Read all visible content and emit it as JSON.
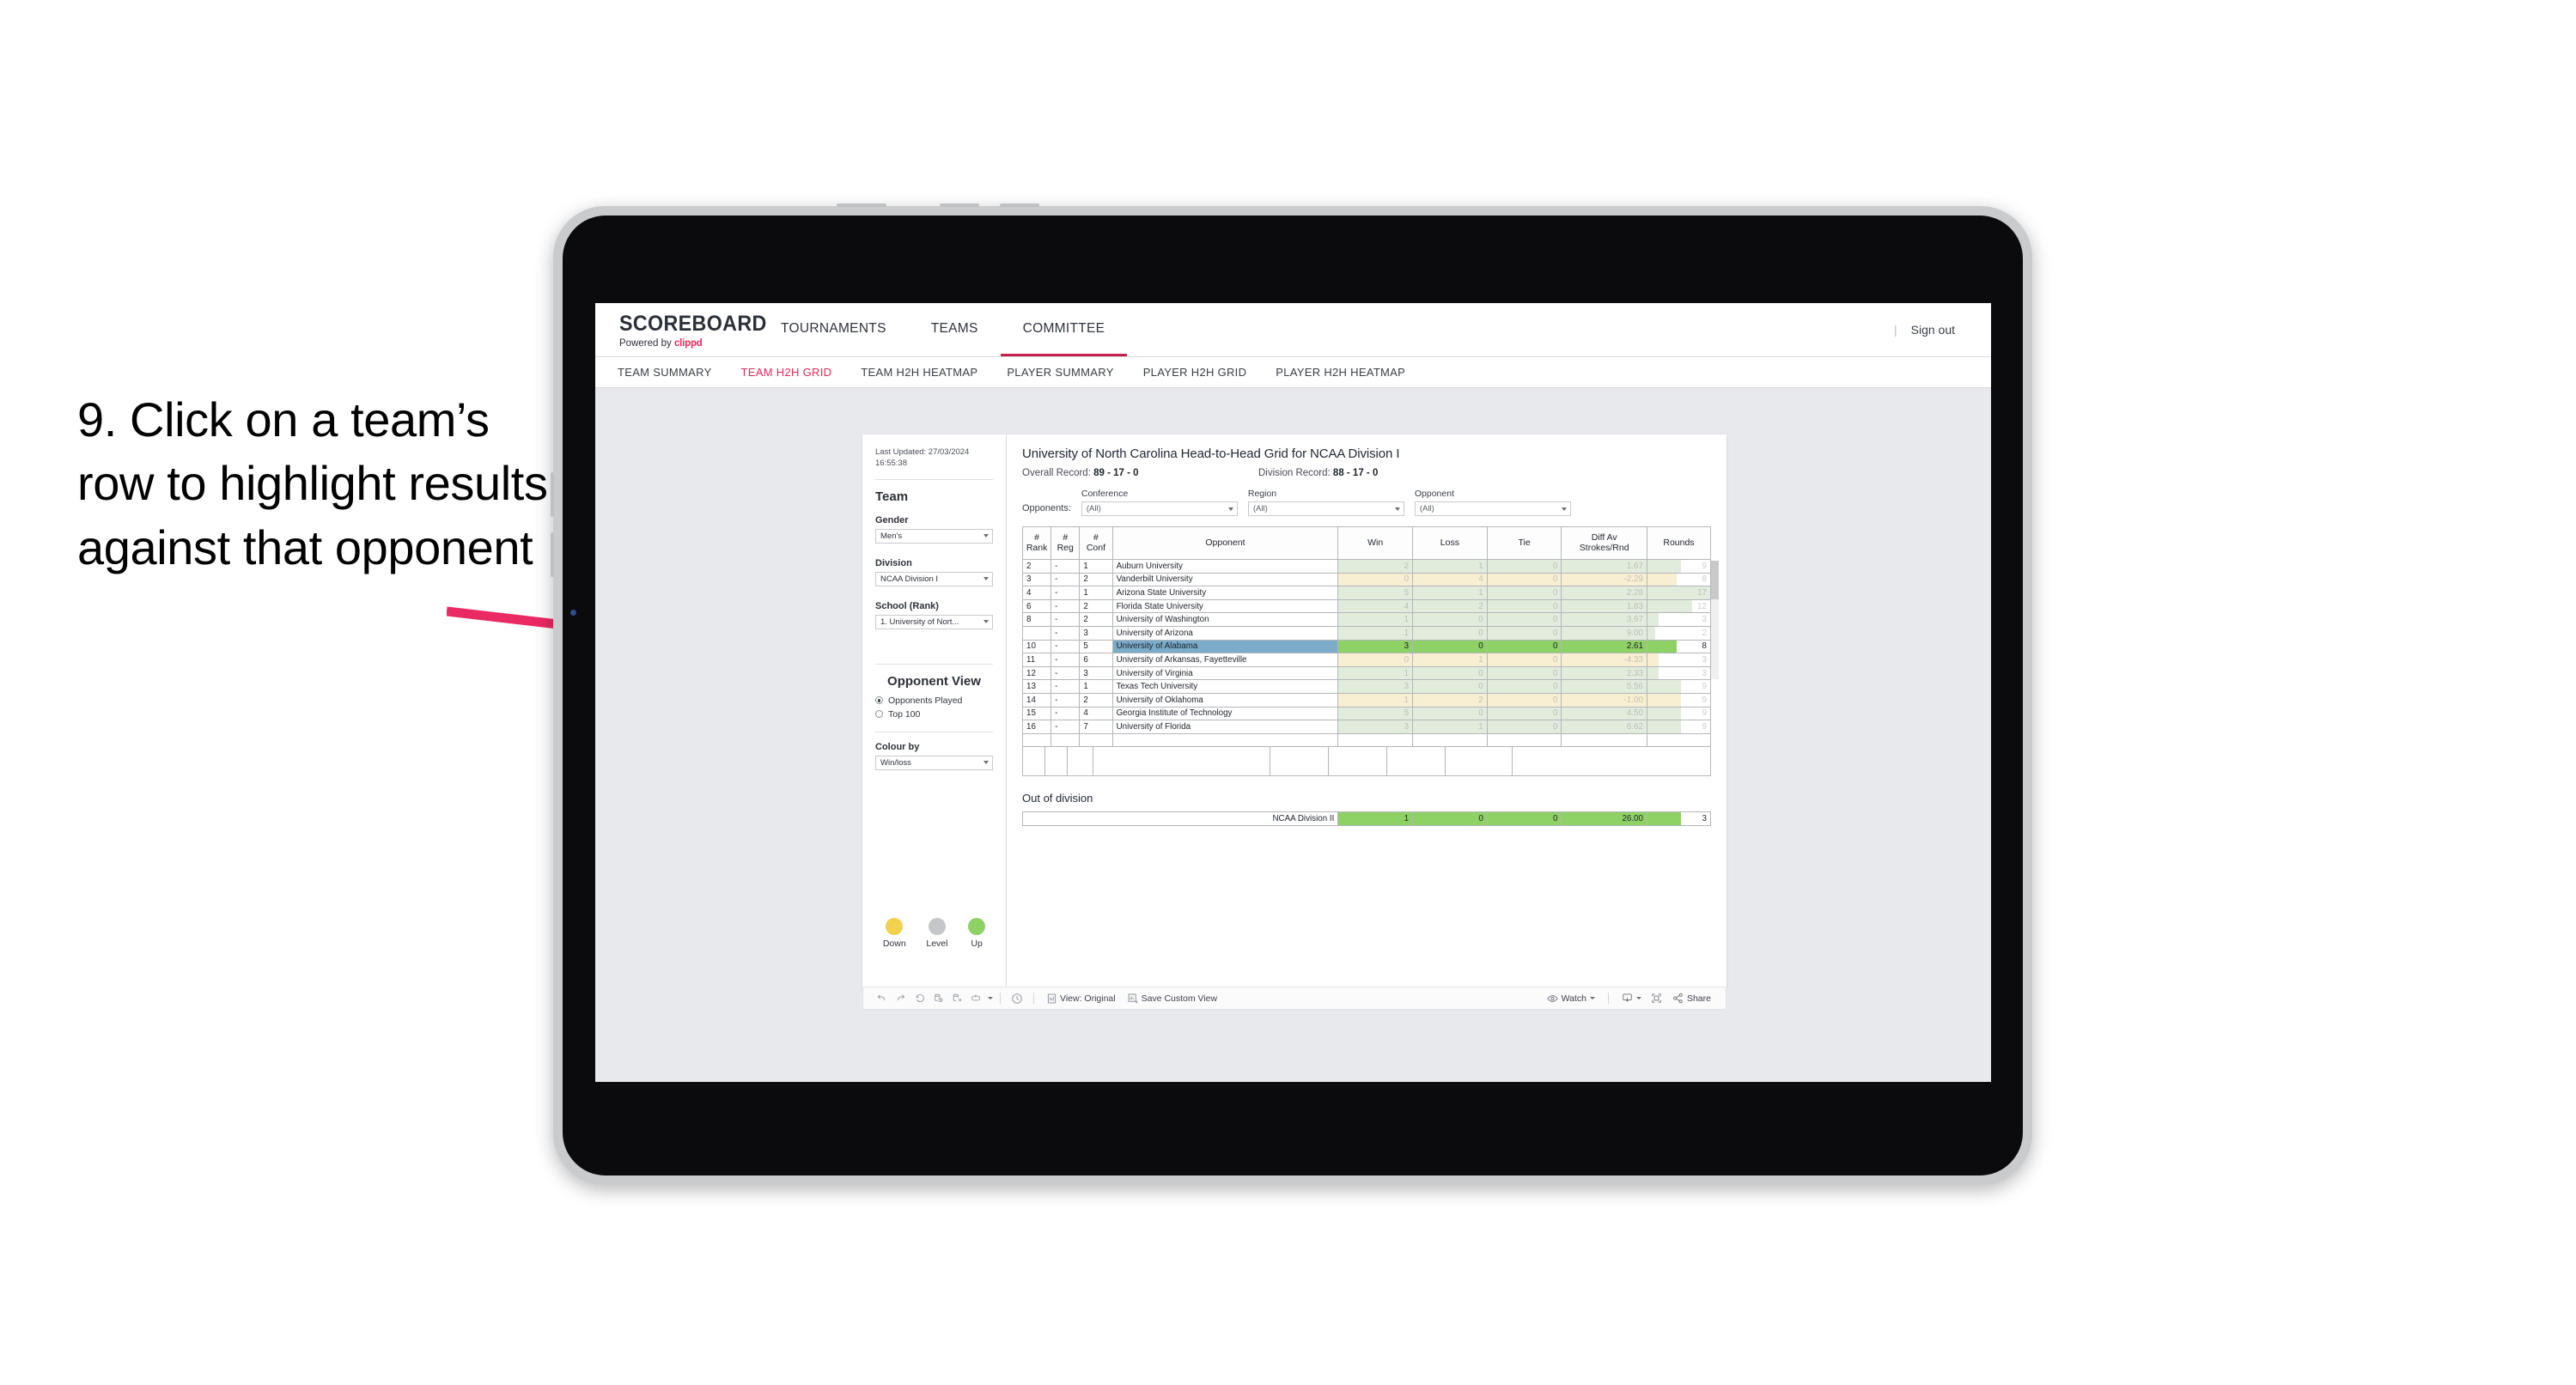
{
  "caption": "9. Click on a team’s row to highlight results against that opponent",
  "accent_pink": "#e8285a",
  "arrow_color": "#ea2a63",
  "topnav": {
    "logo": "SCOREBOARD",
    "powered_prefix": "Powered by ",
    "powered_brand": "clippd",
    "items": [
      {
        "label": "TOURNAMENTS",
        "active": false
      },
      {
        "label": "TEAMS",
        "active": false
      },
      {
        "label": "COMMITTEE",
        "active": true
      }
    ],
    "divider": "|",
    "signout": "Sign out"
  },
  "subnav": {
    "items": [
      {
        "label": "TEAM SUMMARY",
        "active": false
      },
      {
        "label": "TEAM H2H GRID",
        "active": true
      },
      {
        "label": "TEAM H2H HEATMAP",
        "active": false
      },
      {
        "label": "PLAYER SUMMARY",
        "active": false
      },
      {
        "label": "PLAYER H2H GRID",
        "active": false
      },
      {
        "label": "PLAYER H2H HEATMAP",
        "active": false
      }
    ]
  },
  "panel": {
    "last_updated": "Last Updated: 27/03/2024 16:55:38",
    "team_heading": "Team",
    "gender_label": "Gender",
    "gender_value": "Men’s",
    "division_label": "Division",
    "division_value": "NCAA Division I",
    "school_label": "School (Rank)",
    "school_value": "1. University of Nort...",
    "opponent_view_heading": "Opponent View",
    "opponent_view_options": [
      {
        "label": "Opponents Played",
        "selected": true
      },
      {
        "label": "Top 100",
        "selected": false
      }
    ],
    "colour_by_label": "Colour by",
    "colour_by_value": "Win/loss",
    "legend": [
      {
        "label": "Down",
        "color": "#f2d14e"
      },
      {
        "label": "Level",
        "color": "#c4c6c9"
      },
      {
        "label": "Up",
        "color": "#8ed164"
      }
    ]
  },
  "report": {
    "title": "University of North Carolina Head-to-Head Grid for NCAA Division I",
    "overall_record_label": "Overall Record: ",
    "overall_record_value": "89 - 17 - 0",
    "division_record_label": "Division Record: ",
    "division_record_value": "88 - 17 - 0",
    "opponents_label": "Opponents:",
    "filters": [
      {
        "label": "Conference",
        "value": "(All)"
      },
      {
        "label": "Region",
        "value": "(All)"
      },
      {
        "label": "Opponent",
        "value": "(All)"
      }
    ]
  },
  "chart_data": {
    "type": "table",
    "title": "University of North Carolina Head-to-Head Grid for NCAA Division I",
    "columns": [
      "# Rank",
      "# Reg",
      "# Conf",
      "Opponent",
      "Win",
      "Loss",
      "Tie",
      "Diff Av Strokes/Rnd",
      "Rounds"
    ],
    "column_lines": [
      [
        "#",
        "Rank"
      ],
      [
        "#",
        "Reg"
      ],
      [
        "#",
        "Conf"
      ],
      [
        "",
        "Opponent"
      ],
      [
        "",
        "Win"
      ],
      [
        "",
        "Loss"
      ],
      [
        "",
        "Tie"
      ],
      [
        "Diff Av",
        "Strokes/Rnd"
      ],
      [
        "",
        "Rounds"
      ]
    ],
    "rounds_max": 17,
    "rows": [
      {
        "rank": "2",
        "reg": "-",
        "conf": "1",
        "opponent": "Auburn University",
        "win": "2",
        "loss": "1",
        "tie": "0",
        "diff": "1.67",
        "rounds": "9",
        "rounds_n": 9,
        "result": "up",
        "selected": false
      },
      {
        "rank": "3",
        "reg": "-",
        "conf": "2",
        "opponent": "Vanderbilt University",
        "win": "0",
        "loss": "4",
        "tie": "0",
        "diff": "-2.29",
        "rounds": "8",
        "rounds_n": 8,
        "result": "down",
        "selected": false
      },
      {
        "rank": "4",
        "reg": "-",
        "conf": "1",
        "opponent": "Arizona State University",
        "win": "5",
        "loss": "1",
        "tie": "0",
        "diff": "2.28",
        "rounds": "17",
        "rounds_n": 17,
        "result": "up",
        "selected": false
      },
      {
        "rank": "6",
        "reg": "-",
        "conf": "2",
        "opponent": "Florida State University",
        "win": "4",
        "loss": "2",
        "tie": "0",
        "diff": "1.83",
        "rounds": "12",
        "rounds_n": 12,
        "result": "up",
        "selected": false
      },
      {
        "rank": "8",
        "reg": "-",
        "conf": "2",
        "opponent": "University of Washington",
        "win": "1",
        "loss": "0",
        "tie": "0",
        "diff": "3.67",
        "rounds": "3",
        "rounds_n": 3,
        "result": "up",
        "selected": false
      },
      {
        "rank": "",
        "reg": "-",
        "conf": "3",
        "opponent": "University of Arizona",
        "win": "1",
        "loss": "0",
        "tie": "0",
        "diff": "9.00",
        "rounds": "2",
        "rounds_n": 2,
        "result": "up",
        "selected": false
      },
      {
        "rank": "10",
        "reg": "-",
        "conf": "5",
        "opponent": "University of Alabama",
        "win": "3",
        "loss": "0",
        "tie": "0",
        "diff": "2.61",
        "rounds": "8",
        "rounds_n": 8,
        "result": "up",
        "selected": true
      },
      {
        "rank": "11",
        "reg": "-",
        "conf": "6",
        "opponent": "University of Arkansas, Fayetteville",
        "win": "0",
        "loss": "1",
        "tie": "0",
        "diff": "-4.33",
        "rounds": "3",
        "rounds_n": 3,
        "result": "down",
        "selected": false
      },
      {
        "rank": "12",
        "reg": "-",
        "conf": "3",
        "opponent": "University of Virginia",
        "win": "1",
        "loss": "0",
        "tie": "0",
        "diff": "2.33",
        "rounds": "3",
        "rounds_n": 3,
        "result": "up",
        "selected": false
      },
      {
        "rank": "13",
        "reg": "-",
        "conf": "1",
        "opponent": "Texas Tech University",
        "win": "3",
        "loss": "0",
        "tie": "0",
        "diff": "5.56",
        "rounds": "9",
        "rounds_n": 9,
        "result": "up",
        "selected": false
      },
      {
        "rank": "14",
        "reg": "-",
        "conf": "2",
        "opponent": "University of Oklahoma",
        "win": "1",
        "loss": "2",
        "tie": "0",
        "diff": "-1.00",
        "rounds": "9",
        "rounds_n": 9,
        "result": "down",
        "selected": false
      },
      {
        "rank": "15",
        "reg": "-",
        "conf": "4",
        "opponent": "Georgia Institute of Technology",
        "win": "5",
        "loss": "0",
        "tie": "0",
        "diff": "4.50",
        "rounds": "9",
        "rounds_n": 9,
        "result": "up",
        "selected": false
      },
      {
        "rank": "16",
        "reg": "-",
        "conf": "7",
        "opponent": "University of Florida",
        "win": "3",
        "loss": "1",
        "tie": "0",
        "diff": "6.62",
        "rounds": "9",
        "rounds_n": 9,
        "result": "up",
        "selected": false
      }
    ]
  },
  "out_of_division": {
    "title": "Out of division",
    "row": {
      "label": "NCAA Division II",
      "win": "1",
      "loss": "0",
      "tie": "0",
      "diff": "26.00",
      "rounds": "3"
    }
  },
  "toolbar": {
    "icons": [
      "undo-icon",
      "redo-icon",
      "revert-icon",
      "refresh-icon",
      "pause-icon",
      "loop-icon"
    ],
    "view_label": "View: Original",
    "save_label": "Save Custom View",
    "watch_label": "Watch",
    "share_label": "Share"
  }
}
